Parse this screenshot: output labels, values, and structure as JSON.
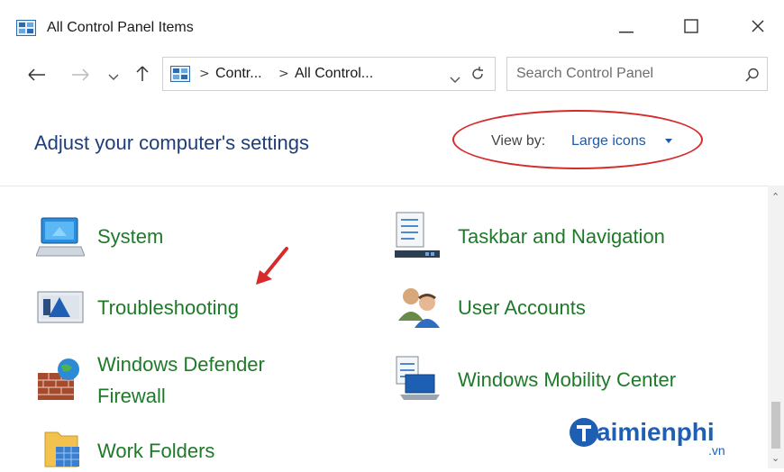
{
  "window": {
    "title": "All Control Panel Items",
    "icons": {
      "app": "control-panel-icon",
      "minimize": "minimize-icon",
      "maximize": "maximize-icon",
      "close": "close-icon"
    }
  },
  "address_bar": {
    "crumbs": [
      "Contr...",
      "All Control..."
    ],
    "icons": [
      "back-arrow-icon",
      "forward-arrow-icon",
      "recent-dropdown-icon",
      "up-arrow-icon",
      "dropdown-chevron-icon",
      "refresh-icon"
    ]
  },
  "search": {
    "placeholder": "Search Control Panel",
    "icon": "search-icon"
  },
  "header": {
    "title": "Adjust your computer's settings",
    "view_by_label": "View by:",
    "view_by_value": "Large icons"
  },
  "items": {
    "left": [
      {
        "label": "System",
        "icon": "system-icon"
      },
      {
        "label": "Troubleshooting",
        "icon": "troubleshooting-icon"
      },
      {
        "label": "Windows Defender",
        "label2": "Firewall",
        "icon": "firewall-icon"
      },
      {
        "label": "Work Folders",
        "icon": "work-folders-icon"
      }
    ],
    "right": [
      {
        "label": "Taskbar and Navigation",
        "icon": "taskbar-icon"
      },
      {
        "label": "User Accounts",
        "icon": "user-accounts-icon"
      },
      {
        "label": "Windows Mobility Center",
        "icon": "mobility-center-icon"
      }
    ]
  },
  "watermark": {
    "brand": "aimienphi",
    "suffix": ".vn"
  },
  "colors": {
    "link_green": "#1e7a28",
    "heading_blue": "#1e3e7a",
    "accent_blue": "#1e5aa8",
    "highlight_red": "#d72b2b"
  }
}
